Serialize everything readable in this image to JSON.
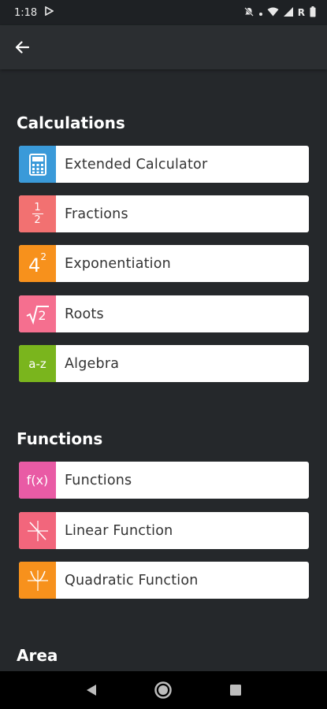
{
  "status_bar": {
    "time": "1:18",
    "carrier_indicator": "R"
  },
  "app_bar": {
    "back_icon": "arrow-left-icon"
  },
  "sections": [
    {
      "title": "Calculations",
      "items": [
        {
          "label": "Extended Calculator",
          "icon": "calculator-icon",
          "color": "#3a9ad9"
        },
        {
          "label": "Fractions",
          "icon": "fraction-icon",
          "icon_text_top": "1",
          "icon_text_bottom": "2",
          "color": "#f27171"
        },
        {
          "label": "Exponentiation",
          "icon": "exponent-icon",
          "icon_text_base": "4",
          "icon_text_exp": "2",
          "color": "#f7911c"
        },
        {
          "label": "Roots",
          "icon": "square-root-icon",
          "icon_text": "2",
          "color": "#f56f8f"
        },
        {
          "label": "Algebra",
          "icon": "algebra-icon",
          "icon_text": "a-z",
          "color": "#7ab51d"
        }
      ]
    },
    {
      "title": "Functions",
      "items": [
        {
          "label": "Functions",
          "icon": "function-icon",
          "icon_text": "f(x)",
          "color": "#e95ba5"
        },
        {
          "label": "Linear Function",
          "icon": "linear-graph-icon",
          "color": "#f2667c"
        },
        {
          "label": "Quadratic Function",
          "icon": "parabola-graph-icon",
          "color": "#f7911c"
        }
      ]
    },
    {
      "title": "Area",
      "items": []
    }
  ]
}
